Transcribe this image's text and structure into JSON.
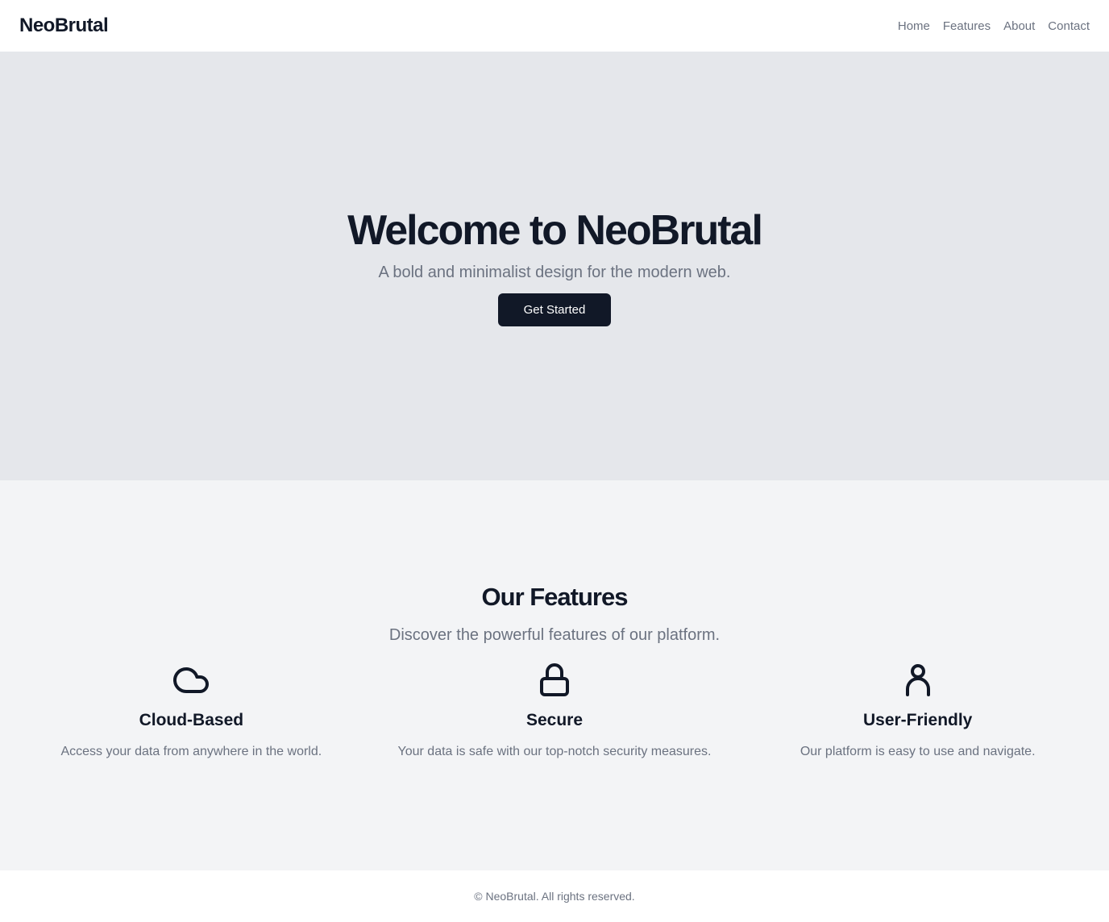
{
  "header": {
    "brand": "NeoBrutal",
    "nav": [
      {
        "label": "Home"
      },
      {
        "label": "Features"
      },
      {
        "label": "About"
      },
      {
        "label": "Contact"
      }
    ]
  },
  "hero": {
    "title": "Welcome to NeoBrutal",
    "subtitle": "A bold and minimalist design for the modern web.",
    "cta_label": "Get Started"
  },
  "features": {
    "title": "Our Features",
    "subtitle": "Discover the powerful features of our platform.",
    "items": [
      {
        "icon": "cloud-icon",
        "title": "Cloud-Based",
        "description": "Access your data from anywhere in the world."
      },
      {
        "icon": "lock-icon",
        "title": "Secure",
        "description": "Your data is safe with our top-notch security measures."
      },
      {
        "icon": "user-icon",
        "title": "User-Friendly",
        "description": "Our platform is easy to use and navigate."
      }
    ]
  },
  "footer": {
    "copyright": "© NeoBrutal. All rights reserved."
  },
  "colors": {
    "primary": "#111827",
    "muted_text": "#6b7280",
    "hero_bg": "#e5e7eb",
    "features_bg": "#f3f4f6"
  }
}
